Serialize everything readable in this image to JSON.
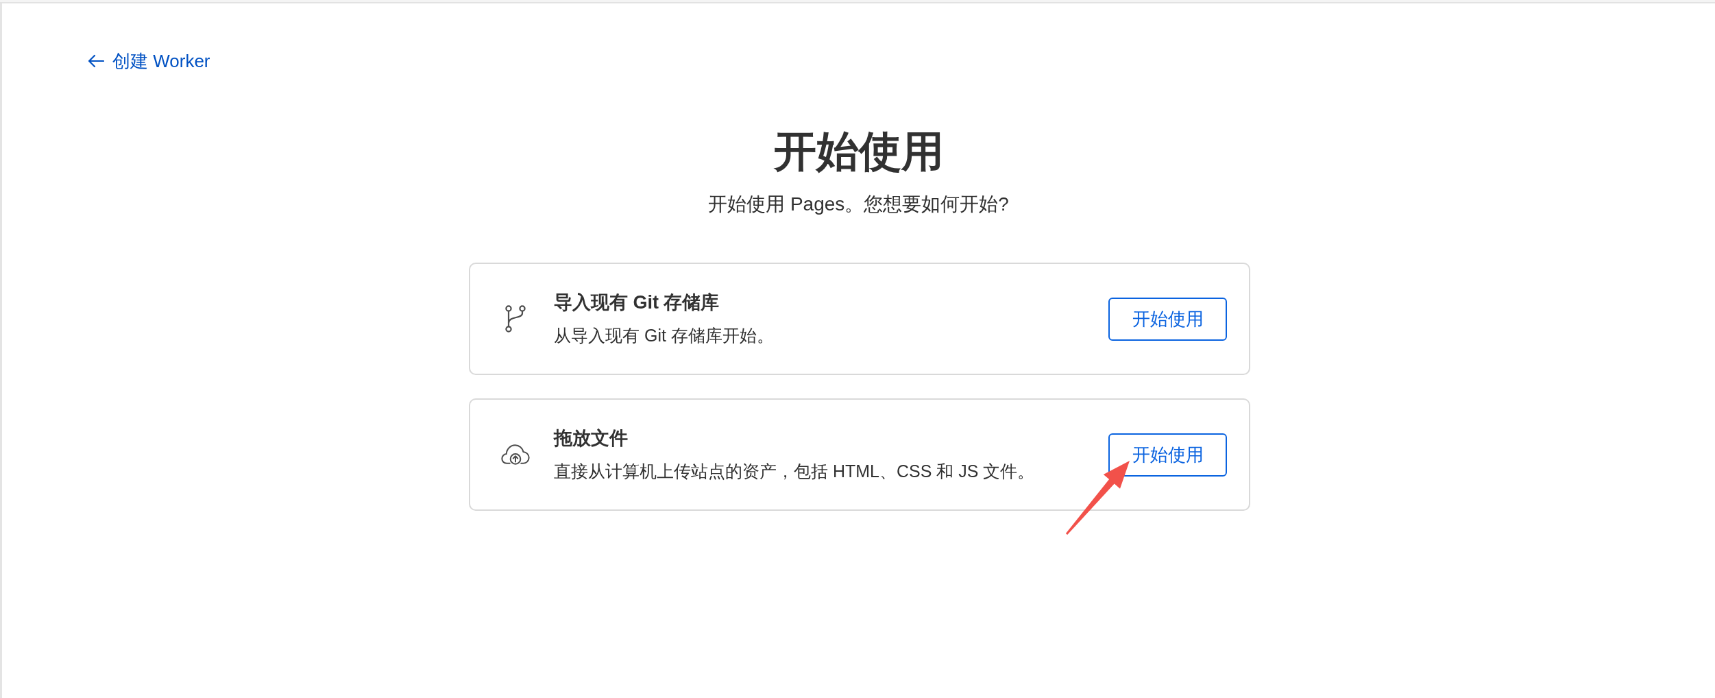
{
  "back_link": {
    "label": "创建 Worker"
  },
  "heading": {
    "title": "开始使用",
    "subtitle": "开始使用 Pages。您想要如何开始?"
  },
  "options": [
    {
      "kind": "repository",
      "title": "导入现有 Git 存储库",
      "description": "从导入现有 Git 存储库开始。",
      "button": "开始使用",
      "annotated": false
    },
    {
      "kind": "upload",
      "title": "拖放文件",
      "description": "直接从计算机上传站点的资产，包括 HTML、CSS 和 JS 文件。",
      "button": "开始使用",
      "annotated": true
    }
  ]
}
